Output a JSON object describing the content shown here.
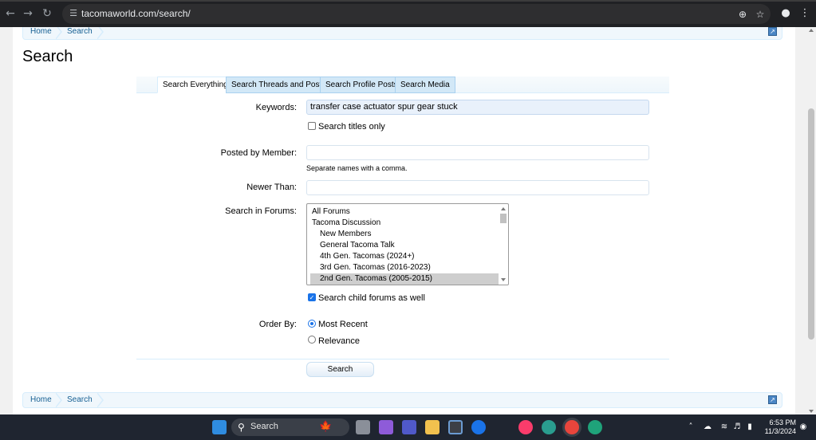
{
  "browser": {
    "url": "tacomaworld.com/search/",
    "icons": [
      "back-arrow-icon",
      "forward-arrow-icon",
      "reload-icon",
      "site-info-icon",
      "zoom-icon",
      "bookmark-star-icon",
      "profile-icon",
      "menu-icon"
    ]
  },
  "breadcrumb": {
    "items": [
      "Home",
      "Search"
    ]
  },
  "page": {
    "title": "Search"
  },
  "tabs": [
    {
      "label": "Search Everything",
      "active": true
    },
    {
      "label": "Search Threads and Posts",
      "active": false
    },
    {
      "label": "Search Profile Posts",
      "active": false
    },
    {
      "label": "Search Media",
      "active": false
    }
  ],
  "form": {
    "keywords_label": "Keywords:",
    "keywords_value": "transfer case actuator spur gear stuck",
    "titles_only_label": "Search titles only",
    "titles_only_checked": false,
    "member_label": "Posted by Member:",
    "member_value": "",
    "member_hint": "Separate names with a comma.",
    "newer_label": "Newer Than:",
    "newer_value": "",
    "forums_label": "Search in Forums:",
    "forums": [
      {
        "label": "All Forums",
        "indent": 0,
        "selected": false
      },
      {
        "label": "Tacoma Discussion",
        "indent": 0,
        "selected": false
      },
      {
        "label": "New Members",
        "indent": 1,
        "selected": false
      },
      {
        "label": "General Tacoma Talk",
        "indent": 1,
        "selected": false
      },
      {
        "label": "4th Gen. Tacomas (2024+)",
        "indent": 1,
        "selected": false
      },
      {
        "label": "3rd Gen. Tacomas (2016-2023)",
        "indent": 1,
        "selected": false
      },
      {
        "label": "2nd Gen. Tacomas (2005-2015)",
        "indent": 1,
        "selected": true
      }
    ],
    "child_forums_label": "Search child forums as well",
    "child_forums_checked": true,
    "order_label": "Order By:",
    "order_options": [
      {
        "label": "Most Recent",
        "selected": true
      },
      {
        "label": "Relevance",
        "selected": false
      }
    ],
    "submit_label": "Search"
  },
  "taskbar": {
    "search_placeholder": "Search",
    "time": "6:53 PM",
    "date": "11/3/2024"
  },
  "colors": {
    "accent": "#176093",
    "tab_bg": "#d2e8f7",
    "breadcrumb_bg": "#f0f7fc",
    "keyword_field_bg": "#e9f1fb",
    "browser_bar": "#202124",
    "taskbar": "#1f2530"
  }
}
